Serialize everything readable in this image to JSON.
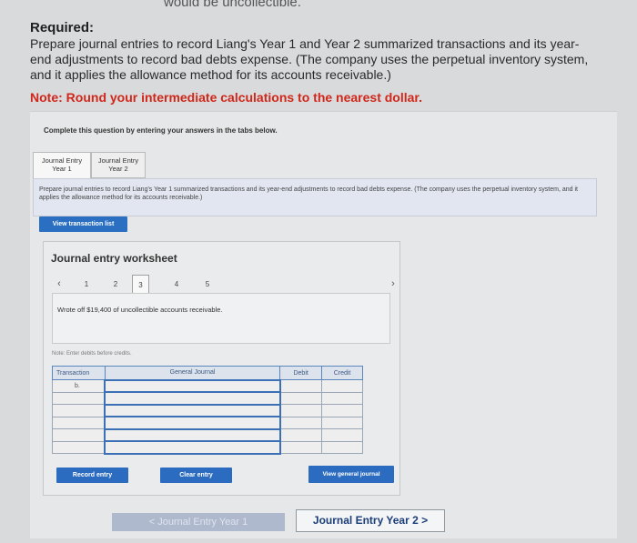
{
  "header": {
    "cut_off_text": "would be uncollectible.",
    "required_label": "Required:",
    "required_body": "Prepare journal entries to record Liang's Year 1 and Year 2 summarized transactions and its year-end adjustments to record bad debts expense. (The company uses the perpetual inventory system, and it applies the allowance method for its accounts receivable.)",
    "note_prefix": "Note:",
    "note_text": "Round your intermediate calculations to the nearest dollar."
  },
  "panel": {
    "complete_text": "Complete this question by entering your answers in the tabs below.",
    "tabs": [
      {
        "line1": "Journal Entry",
        "line2": "Year 1"
      },
      {
        "line1": "Journal Entry",
        "line2": "Year 2"
      }
    ],
    "instructions": "Prepare journal entries to record Liang's Year 1 summarized transactions and its year-end adjustments to record bad debts expense. (The company uses the perpetual inventory system, and it applies the allowance method for its accounts receivable.)",
    "view_transaction_label": "View transaction list"
  },
  "worksheet": {
    "title": "Journal entry worksheet",
    "pages": [
      "1",
      "2",
      "3",
      "4",
      "5"
    ],
    "active_page": "3",
    "prev_icon": "chevron-left-icon",
    "next_icon": "chevron-right-icon",
    "description": "Wrote off $19,400 of uncollectible accounts receivable.",
    "enter_note": "Note: Enter debits before credits.",
    "columns": [
      "Transaction",
      "General Journal",
      "Debit",
      "Credit"
    ],
    "first_transaction": "b.",
    "record_label": "Record entry",
    "clear_label": "Clear entry",
    "view_general_journal_label": "View general journal"
  },
  "footer_nav": {
    "prev_label": "< Journal Entry Year 1",
    "next_label": "Journal Entry Year 2  >"
  },
  "colors": {
    "accent_blue": "#2c6cc0",
    "note_red": "#d0271b"
  }
}
